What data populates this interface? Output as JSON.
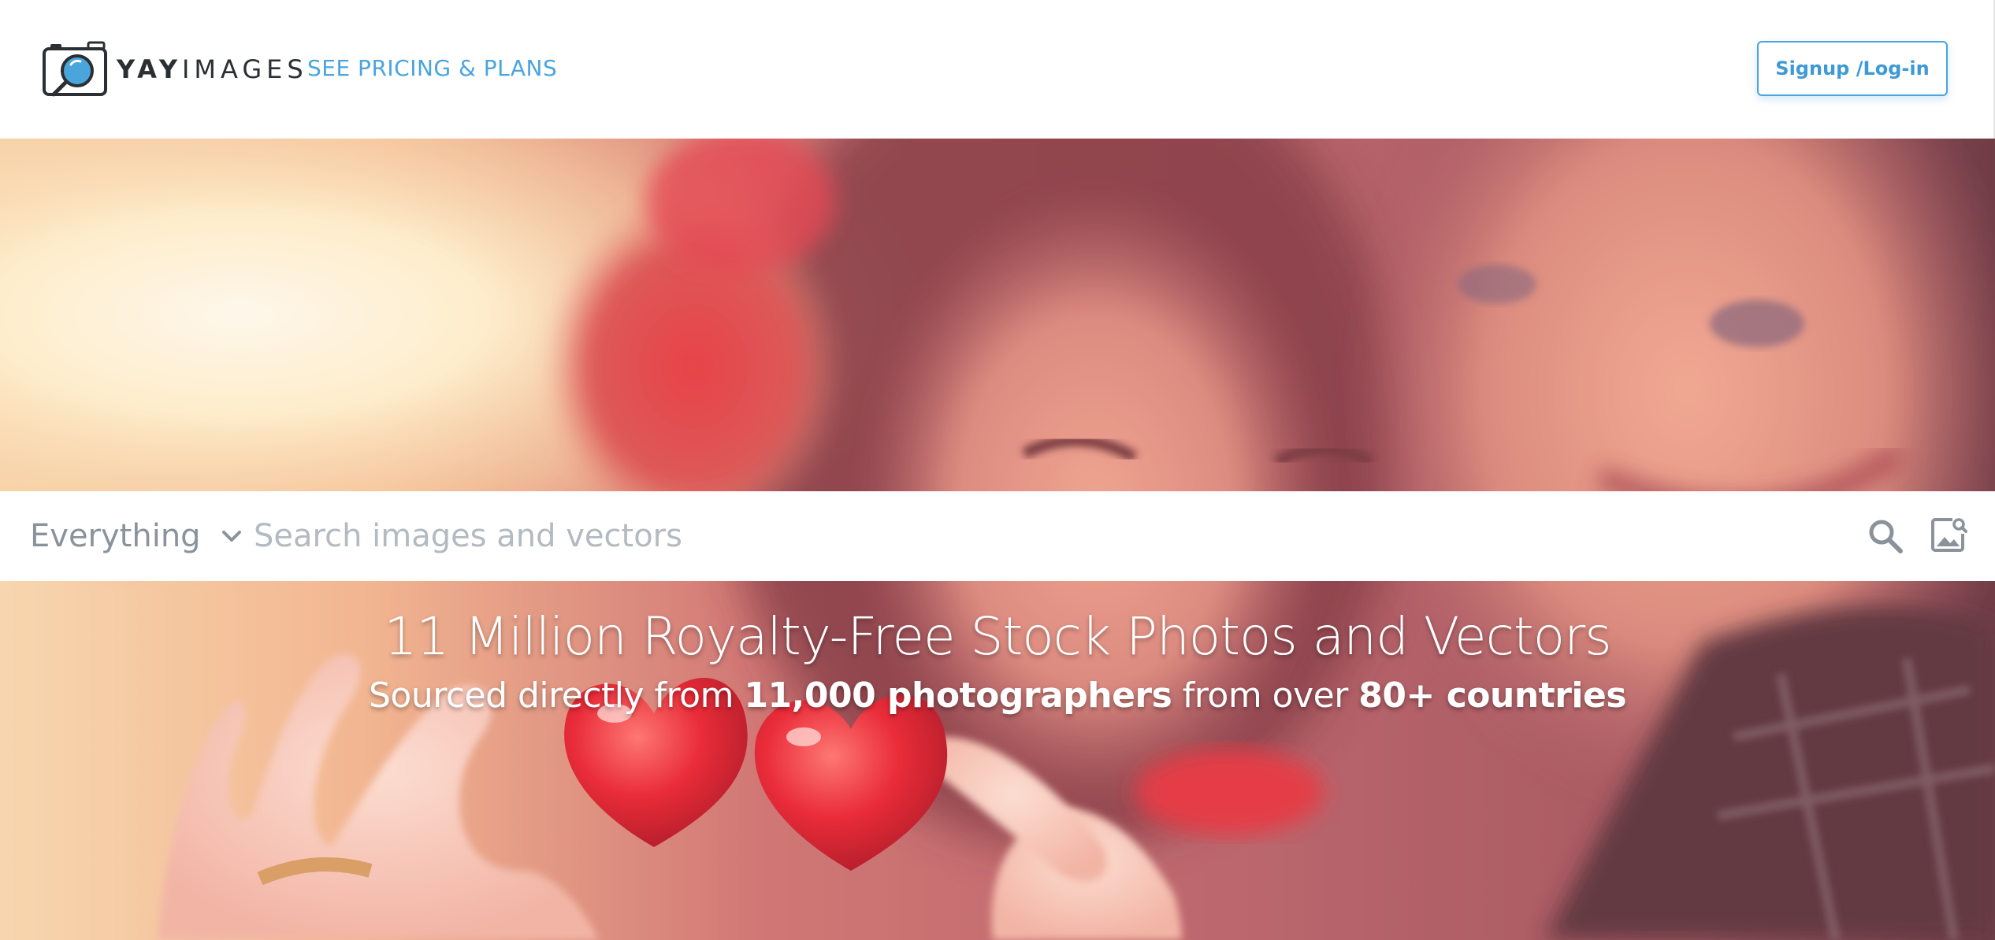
{
  "header": {
    "logo": {
      "text_bold": "YAY",
      "text_regular": "IMAGES"
    },
    "pricing_link": "SEE PRICING & PLANS",
    "signup_button": "Signup /Log-in"
  },
  "search": {
    "filter_selected": "Everything",
    "placeholder": "Search images and vectors"
  },
  "hero": {
    "headline": "11 Million Royalty-Free Stock Photos and Vectors",
    "subline": {
      "part1": "Sourced directly from ",
      "bold1": "11,000 photographers",
      "part2": " from over ",
      "bold2": "80+ countries"
    }
  },
  "colors": {
    "accent": "#4aa5dd",
    "logo_text": "#2b2f33",
    "filter_text": "#8a939c",
    "placeholder": "#b3bac1"
  },
  "icons": {
    "logo": "camera-magnifier-icon",
    "filter_chevron": "chevron-down-icon",
    "search": "search-icon",
    "image_search": "image-search-icon"
  }
}
